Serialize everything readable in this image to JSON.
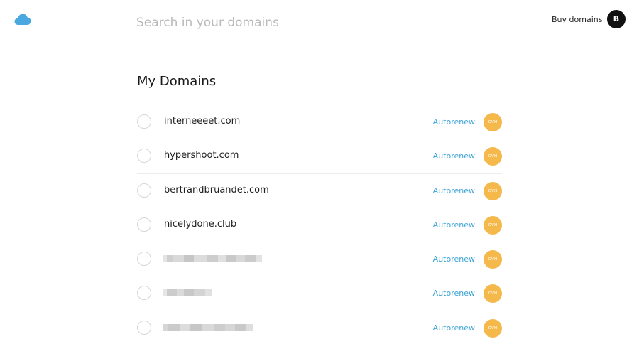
{
  "header": {
    "search_placeholder": "Search in your domains",
    "buy_label": "Buy domains",
    "avatar_initial": "B"
  },
  "page": {
    "title": "My Domains"
  },
  "domains": [
    {
      "name": "interneeeet.com",
      "renew_label": "Autorenew",
      "registrar": "OVH",
      "redacted": false
    },
    {
      "name": "hypershoot.com",
      "renew_label": "Autorenew",
      "registrar": "OVH",
      "redacted": false
    },
    {
      "name": "bertrandbruandet.com",
      "renew_label": "Autorenew",
      "registrar": "OVH",
      "redacted": false
    },
    {
      "name": "nicelydone.club",
      "renew_label": "Autorenew",
      "registrar": "OVH",
      "redacted": false
    },
    {
      "name": "",
      "renew_label": "Autorenew",
      "registrar": "OVH",
      "redacted": true
    },
    {
      "name": "",
      "renew_label": "Autorenew",
      "registrar": "OVH",
      "redacted": true
    },
    {
      "name": "",
      "renew_label": "Autorenew",
      "registrar": "OVH",
      "redacted": true
    }
  ],
  "colors": {
    "accent": "#3aa3d6",
    "registrar_badge": "#f5b84a",
    "logo": "#4aa8e0"
  },
  "icons": {
    "logo": "cloud-icon"
  }
}
